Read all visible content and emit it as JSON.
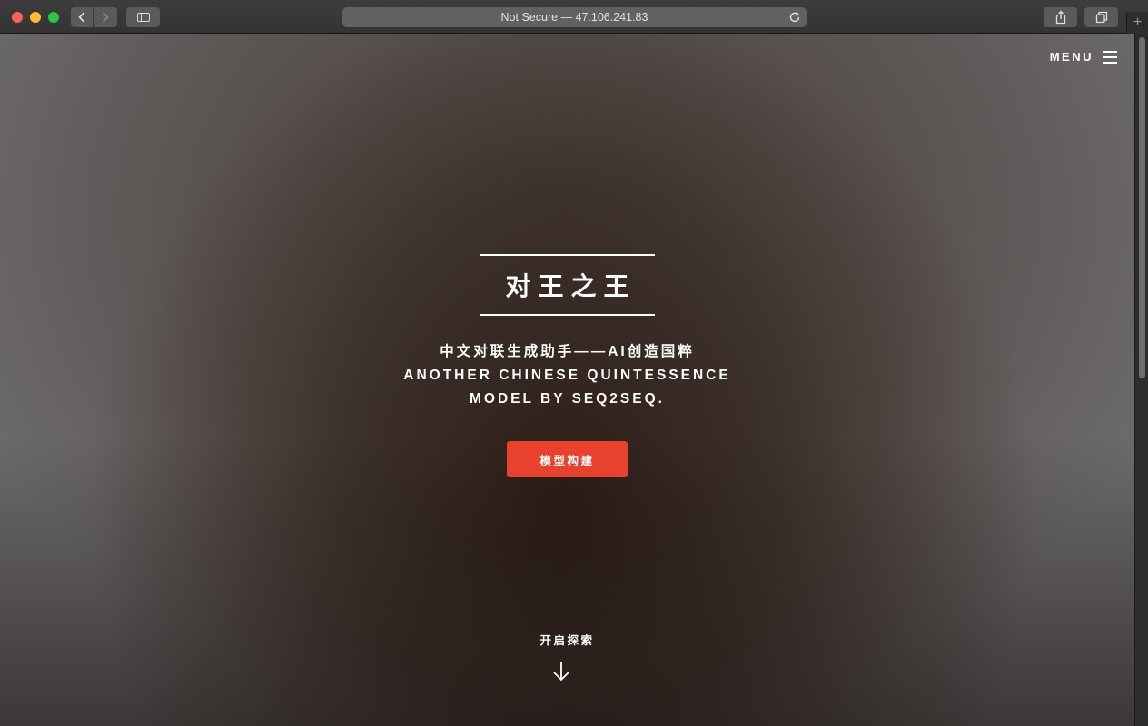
{
  "browser": {
    "address": "Not Secure — 47.106.241.83",
    "back_icon": "chevron-left-icon",
    "forward_icon": "chevron-right-icon",
    "reload_icon": "reload-icon",
    "new_tab_label": "+"
  },
  "nav": {
    "menu_label": "MENU"
  },
  "hero": {
    "title": "对王之王",
    "subtitle_line1": "中文对联生成助手——AI创造国粹",
    "subtitle_line2": "ANOTHER CHINESE QUINTESSENCE",
    "subtitle_line3_prefix": "MODEL BY ",
    "subtitle_link": "SEQ2SEQ",
    "subtitle_line3_suffix": ".",
    "cta_label": "模型构建",
    "explore_label": "开启探索"
  },
  "colors": {
    "accent": "#e8422f",
    "text": "#ffffff"
  }
}
